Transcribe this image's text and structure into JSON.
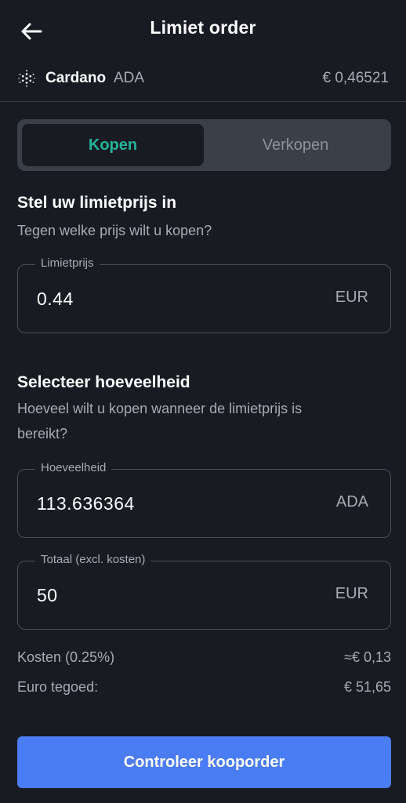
{
  "header": {
    "title": "Limiet order",
    "back_icon": "arrow-left-icon"
  },
  "asset": {
    "icon": "cardano-logo-icon",
    "name": "Cardano",
    "ticker": "ADA",
    "price": "€ 0,46521"
  },
  "toggle": {
    "buy_label": "Kopen",
    "sell_label": "Verkopen",
    "selected": "buy"
  },
  "limit_section": {
    "title": "Stel uw limietprijs in",
    "subtitle": "Tegen welke prijs wilt u kopen?",
    "field": {
      "label": "Limietprijs",
      "value": "0.44",
      "unit": "EUR"
    }
  },
  "amount_section": {
    "title": "Selecteer hoeveelheid",
    "subtitle_line1": "Hoeveel wilt u kopen wanneer de limietprijs is",
    "subtitle_line2": "bereikt?",
    "quantity_field": {
      "label": "Hoeveelheid",
      "value": "113.636364",
      "unit": "ADA"
    },
    "total_field": {
      "label": "Totaal (excl. kosten)",
      "value": "50",
      "unit": "EUR"
    }
  },
  "summary": {
    "fees_label": "Kosten (0.25%)",
    "fees_value": "≈€ 0,13",
    "balance_label": "Euro tegoed:",
    "balance_value": "€ 51,65"
  },
  "cta": {
    "label": "Controleer kooporder"
  },
  "colors": {
    "background": "#181b22",
    "accent_buy": "#23b39a",
    "cta_blue": "#4a7cf3",
    "muted_text": "#a7abb3"
  }
}
